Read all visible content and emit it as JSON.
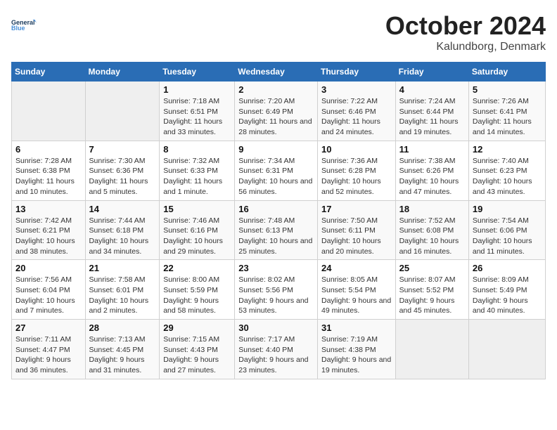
{
  "logo": {
    "line1": "General",
    "line2": "Blue"
  },
  "title": "October 2024",
  "subtitle": "Kalundborg, Denmark",
  "days_header": [
    "Sunday",
    "Monday",
    "Tuesday",
    "Wednesday",
    "Thursday",
    "Friday",
    "Saturday"
  ],
  "weeks": [
    [
      {
        "num": "",
        "sunrise": "",
        "sunset": "",
        "daylight": ""
      },
      {
        "num": "",
        "sunrise": "",
        "sunset": "",
        "daylight": ""
      },
      {
        "num": "1",
        "sunrise": "Sunrise: 7:18 AM",
        "sunset": "Sunset: 6:51 PM",
        "daylight": "Daylight: 11 hours and 33 minutes."
      },
      {
        "num": "2",
        "sunrise": "Sunrise: 7:20 AM",
        "sunset": "Sunset: 6:49 PM",
        "daylight": "Daylight: 11 hours and 28 minutes."
      },
      {
        "num": "3",
        "sunrise": "Sunrise: 7:22 AM",
        "sunset": "Sunset: 6:46 PM",
        "daylight": "Daylight: 11 hours and 24 minutes."
      },
      {
        "num": "4",
        "sunrise": "Sunrise: 7:24 AM",
        "sunset": "Sunset: 6:44 PM",
        "daylight": "Daylight: 11 hours and 19 minutes."
      },
      {
        "num": "5",
        "sunrise": "Sunrise: 7:26 AM",
        "sunset": "Sunset: 6:41 PM",
        "daylight": "Daylight: 11 hours and 14 minutes."
      }
    ],
    [
      {
        "num": "6",
        "sunrise": "Sunrise: 7:28 AM",
        "sunset": "Sunset: 6:38 PM",
        "daylight": "Daylight: 11 hours and 10 minutes."
      },
      {
        "num": "7",
        "sunrise": "Sunrise: 7:30 AM",
        "sunset": "Sunset: 6:36 PM",
        "daylight": "Daylight: 11 hours and 5 minutes."
      },
      {
        "num": "8",
        "sunrise": "Sunrise: 7:32 AM",
        "sunset": "Sunset: 6:33 PM",
        "daylight": "Daylight: 11 hours and 1 minute."
      },
      {
        "num": "9",
        "sunrise": "Sunrise: 7:34 AM",
        "sunset": "Sunset: 6:31 PM",
        "daylight": "Daylight: 10 hours and 56 minutes."
      },
      {
        "num": "10",
        "sunrise": "Sunrise: 7:36 AM",
        "sunset": "Sunset: 6:28 PM",
        "daylight": "Daylight: 10 hours and 52 minutes."
      },
      {
        "num": "11",
        "sunrise": "Sunrise: 7:38 AM",
        "sunset": "Sunset: 6:26 PM",
        "daylight": "Daylight: 10 hours and 47 minutes."
      },
      {
        "num": "12",
        "sunrise": "Sunrise: 7:40 AM",
        "sunset": "Sunset: 6:23 PM",
        "daylight": "Daylight: 10 hours and 43 minutes."
      }
    ],
    [
      {
        "num": "13",
        "sunrise": "Sunrise: 7:42 AM",
        "sunset": "Sunset: 6:21 PM",
        "daylight": "Daylight: 10 hours and 38 minutes."
      },
      {
        "num": "14",
        "sunrise": "Sunrise: 7:44 AM",
        "sunset": "Sunset: 6:18 PM",
        "daylight": "Daylight: 10 hours and 34 minutes."
      },
      {
        "num": "15",
        "sunrise": "Sunrise: 7:46 AM",
        "sunset": "Sunset: 6:16 PM",
        "daylight": "Daylight: 10 hours and 29 minutes."
      },
      {
        "num": "16",
        "sunrise": "Sunrise: 7:48 AM",
        "sunset": "Sunset: 6:13 PM",
        "daylight": "Daylight: 10 hours and 25 minutes."
      },
      {
        "num": "17",
        "sunrise": "Sunrise: 7:50 AM",
        "sunset": "Sunset: 6:11 PM",
        "daylight": "Daylight: 10 hours and 20 minutes."
      },
      {
        "num": "18",
        "sunrise": "Sunrise: 7:52 AM",
        "sunset": "Sunset: 6:08 PM",
        "daylight": "Daylight: 10 hours and 16 minutes."
      },
      {
        "num": "19",
        "sunrise": "Sunrise: 7:54 AM",
        "sunset": "Sunset: 6:06 PM",
        "daylight": "Daylight: 10 hours and 11 minutes."
      }
    ],
    [
      {
        "num": "20",
        "sunrise": "Sunrise: 7:56 AM",
        "sunset": "Sunset: 6:04 PM",
        "daylight": "Daylight: 10 hours and 7 minutes."
      },
      {
        "num": "21",
        "sunrise": "Sunrise: 7:58 AM",
        "sunset": "Sunset: 6:01 PM",
        "daylight": "Daylight: 10 hours and 2 minutes."
      },
      {
        "num": "22",
        "sunrise": "Sunrise: 8:00 AM",
        "sunset": "Sunset: 5:59 PM",
        "daylight": "Daylight: 9 hours and 58 minutes."
      },
      {
        "num": "23",
        "sunrise": "Sunrise: 8:02 AM",
        "sunset": "Sunset: 5:56 PM",
        "daylight": "Daylight: 9 hours and 53 minutes."
      },
      {
        "num": "24",
        "sunrise": "Sunrise: 8:05 AM",
        "sunset": "Sunset: 5:54 PM",
        "daylight": "Daylight: 9 hours and 49 minutes."
      },
      {
        "num": "25",
        "sunrise": "Sunrise: 8:07 AM",
        "sunset": "Sunset: 5:52 PM",
        "daylight": "Daylight: 9 hours and 45 minutes."
      },
      {
        "num": "26",
        "sunrise": "Sunrise: 8:09 AM",
        "sunset": "Sunset: 5:49 PM",
        "daylight": "Daylight: 9 hours and 40 minutes."
      }
    ],
    [
      {
        "num": "27",
        "sunrise": "Sunrise: 7:11 AM",
        "sunset": "Sunset: 4:47 PM",
        "daylight": "Daylight: 9 hours and 36 minutes."
      },
      {
        "num": "28",
        "sunrise": "Sunrise: 7:13 AM",
        "sunset": "Sunset: 4:45 PM",
        "daylight": "Daylight: 9 hours and 31 minutes."
      },
      {
        "num": "29",
        "sunrise": "Sunrise: 7:15 AM",
        "sunset": "Sunset: 4:43 PM",
        "daylight": "Daylight: 9 hours and 27 minutes."
      },
      {
        "num": "30",
        "sunrise": "Sunrise: 7:17 AM",
        "sunset": "Sunset: 4:40 PM",
        "daylight": "Daylight: 9 hours and 23 minutes."
      },
      {
        "num": "31",
        "sunrise": "Sunrise: 7:19 AM",
        "sunset": "Sunset: 4:38 PM",
        "daylight": "Daylight: 9 hours and 19 minutes."
      },
      {
        "num": "",
        "sunrise": "",
        "sunset": "",
        "daylight": ""
      },
      {
        "num": "",
        "sunrise": "",
        "sunset": "",
        "daylight": ""
      }
    ]
  ]
}
